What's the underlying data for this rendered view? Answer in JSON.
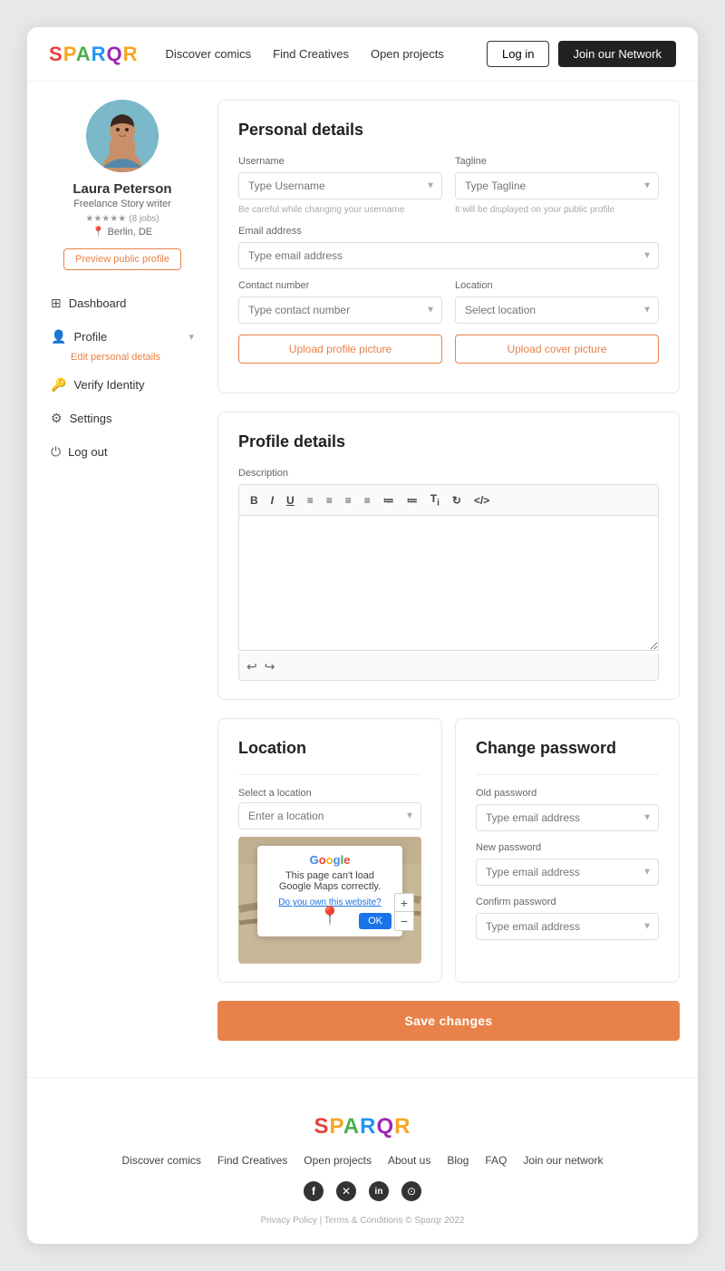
{
  "header": {
    "logo": "SPARQR",
    "nav": [
      "Discover comics",
      "Find Creatives",
      "Open projects"
    ],
    "login_label": "Log in",
    "join_label": "Join our Network"
  },
  "sidebar": {
    "user": {
      "name": "Laura Peterson",
      "role": "Freelance Story writer",
      "rating_count": "(8 jobs)",
      "location": "Berlin, DE",
      "stars": "★★★★★"
    },
    "preview_btn": "Preview public profile",
    "nav_items": [
      {
        "id": "dashboard",
        "label": "Dashboard",
        "icon": "⊞"
      },
      {
        "id": "profile",
        "label": "Profile",
        "icon": "👤",
        "has_chevron": true,
        "sub": "Edit personal details"
      },
      {
        "id": "verify",
        "label": "Verify Identity",
        "icon": "🔑"
      },
      {
        "id": "settings",
        "label": "Settings",
        "icon": "⚙"
      },
      {
        "id": "logout",
        "label": "Log out",
        "icon": "⏻"
      }
    ]
  },
  "personal_details": {
    "title": "Personal details",
    "username_label": "Username",
    "username_placeholder": "Type Username",
    "username_hint": "Be careful while changing your username",
    "tagline_label": "Tagline",
    "tagline_placeholder": "Type Tagline",
    "tagline_hint": "It will be displayed on your public profile",
    "email_label": "Email address",
    "email_placeholder": "Type email address",
    "contact_label": "Contact number",
    "contact_placeholder": "Type contact number",
    "location_label": "Location",
    "location_placeholder": "Select location",
    "upload_profile_btn": "Upload profile picture",
    "upload_cover_btn": "Upload cover picture"
  },
  "profile_details": {
    "title": "Profile details",
    "description_label": "Description",
    "editor_toolbar": [
      "B",
      "I",
      "U",
      "≡",
      "≡",
      "≡",
      "≡",
      "≡",
      "≡",
      "Tᵢ",
      "↻",
      "</>"
    ]
  },
  "location_section": {
    "title": "Location",
    "select_label": "Select a location",
    "placeholder": "Enter a location",
    "map_google_msg": "This page can't load Google Maps correctly.",
    "map_link": "Do you own this website?",
    "map_ok": "OK"
  },
  "change_password": {
    "title": "Change password",
    "old_label": "Old password",
    "old_placeholder": "Type email address",
    "new_label": "New password",
    "new_placeholder": "Type email address",
    "confirm_label": "Confirm password",
    "confirm_placeholder": "Type email address"
  },
  "save_btn": "Save changes",
  "footer": {
    "logo": "SPARQR",
    "nav": [
      "Discover comics",
      "Find Creatives",
      "Open projects",
      "About us",
      "Blog",
      "FAQ",
      "Join our network"
    ],
    "legal": "Privacy Policy  |  Terms & Conditions © Sparqr 2022",
    "social": [
      "f",
      "t",
      "in",
      "gh"
    ]
  }
}
